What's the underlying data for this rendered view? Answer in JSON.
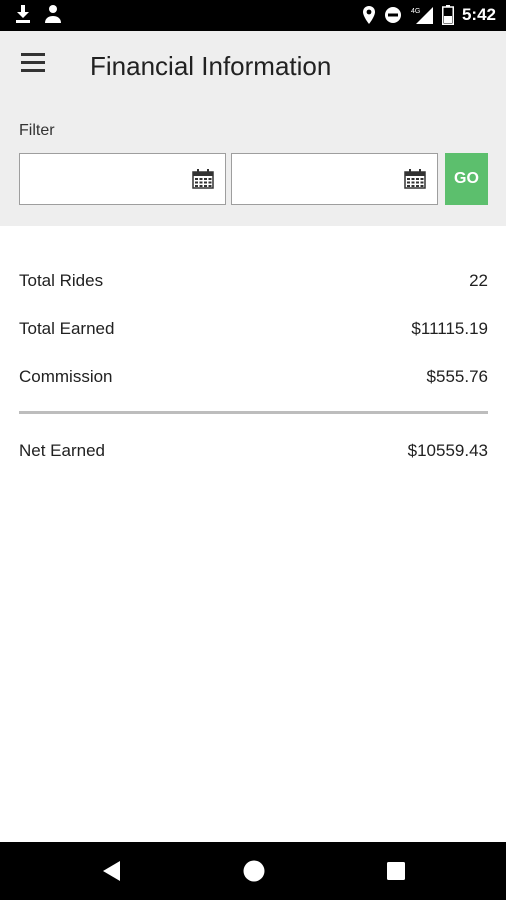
{
  "status_bar": {
    "time": "5:42",
    "left_icons": [
      "download-icon",
      "account-icon"
    ],
    "right_icons": [
      "location-icon",
      "do-not-disturb-icon",
      "signal-4g-icon",
      "battery-icon"
    ],
    "network_label": "4G"
  },
  "header": {
    "title": "Financial Information",
    "menu_icon": "hamburger-menu-icon",
    "filter_label": "Filter",
    "start_date": {
      "value": "",
      "placeholder": ""
    },
    "end_date": {
      "value": "",
      "placeholder": ""
    },
    "go_label": "GO",
    "accent_color": "#5cbf6d"
  },
  "summary": {
    "total_rides": {
      "label": "Total Rides",
      "value": "22"
    },
    "total_earned": {
      "label": "Total Earned",
      "value": "$11115.19"
    },
    "commission": {
      "label": "Commission",
      "value": "$555.76"
    },
    "net_earned": {
      "label": "Net Earned",
      "value": "$10559.43"
    }
  },
  "nav_bar": {
    "buttons": [
      "back-icon",
      "home-icon",
      "recents-icon"
    ]
  }
}
